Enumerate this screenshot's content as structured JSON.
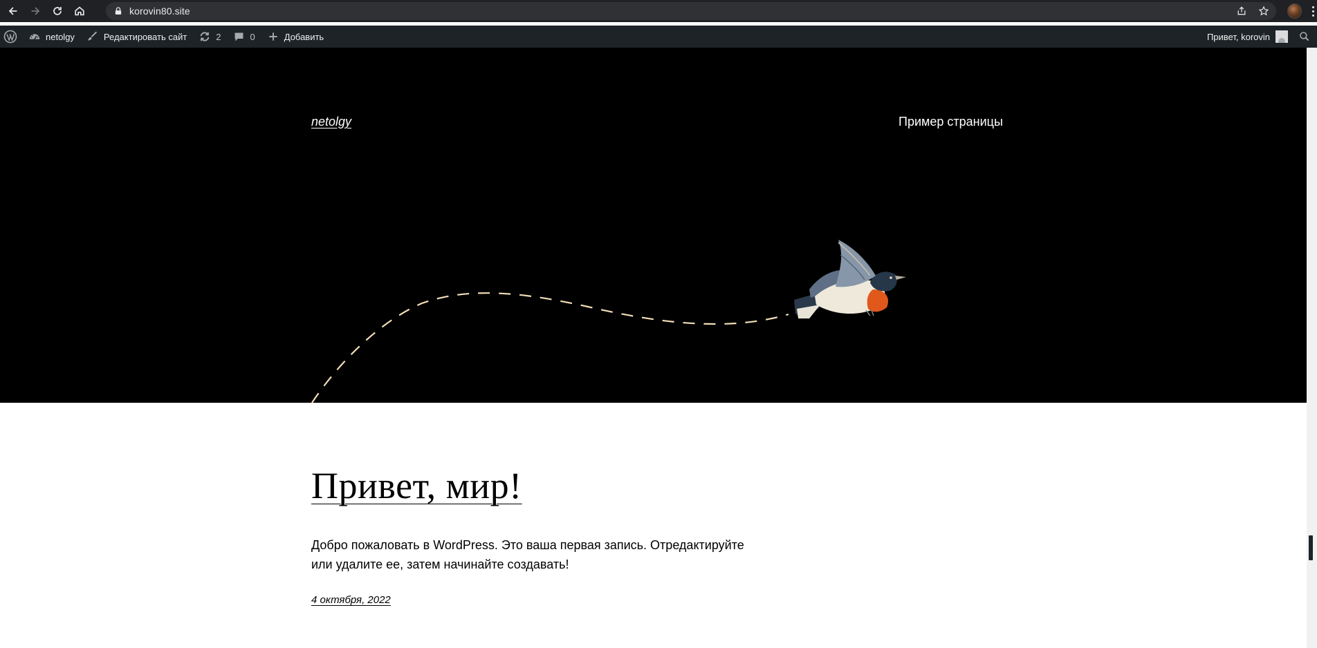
{
  "browser": {
    "url": "korovin80.site",
    "icons": [
      "back-arrow-icon",
      "forward-arrow-icon",
      "reload-icon",
      "home-icon",
      "lock-icon",
      "share-icon",
      "star-icon",
      "profile-avatar",
      "kebab-menu-icon"
    ]
  },
  "adminbar": {
    "site_name": "netolgy",
    "edit_site": "Редактировать сайт",
    "updates_count": "2",
    "comments_count": "0",
    "add_new": "Добавить",
    "greeting": "Привет, korovin"
  },
  "site": {
    "title": "netolgy",
    "nav_page": "Пример страницы"
  },
  "post": {
    "title": "Привет, мир!",
    "excerpt": "Добро пожаловать в WordPress. Это ваша первая запись. Отредактируйте или удалите ее, затем начинайте создавать!",
    "date": "4 октября, 2022"
  },
  "colors": {
    "chrome_bg": "#202124",
    "omnibox_bg": "#303134",
    "adminbar_bg": "#1d2327",
    "hero_bg": "#000000",
    "dashed_line": "#f3dfb9"
  }
}
